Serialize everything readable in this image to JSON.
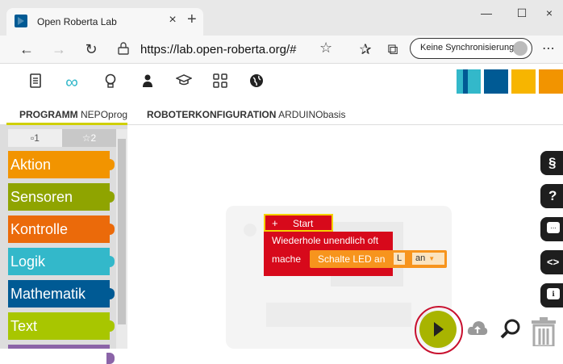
{
  "browser": {
    "tab_title": "Open Roberta Lab",
    "tab_close": "×",
    "new_tab": "+",
    "url": "https://lab.open-roberta.org/#",
    "sync_label": "Keine Synchronisierung",
    "more": "⋯",
    "minimize": "—",
    "maximize": "☐",
    "close": "×"
  },
  "app": {
    "toolbar_icons": [
      "document-icon",
      "infinity-icon",
      "lightbulb-icon",
      "user-icon",
      "graduation-cap-icon",
      "grid-icon",
      "globe-icon"
    ],
    "colors": {
      "accent": "#005a94",
      "yellow": "#f7b500",
      "green": "#a8b400"
    }
  },
  "tabs": {
    "program_label": "PROGRAMM",
    "program_name": "NEPOprog",
    "config_label": "ROBOTERKONFIGURATION",
    "config_name": "ARDUINObasis"
  },
  "toolbox": {
    "tab1": "▫1",
    "tab2": "☆2",
    "categories": [
      {
        "label": "Aktion",
        "color": "#f29400"
      },
      {
        "label": "Sensoren",
        "color": "#8fa400"
      },
      {
        "label": "Kontrolle",
        "color": "#eb6a0a"
      },
      {
        "label": "Logik",
        "color": "#33b8ca"
      },
      {
        "label": "Mathematik",
        "color": "#005a94"
      },
      {
        "label": "Text",
        "color": "#a8c600"
      }
    ]
  },
  "blocks": {
    "start_plus": "+",
    "start_label": "Start",
    "loop_label": "Wiederhole unendlich oft",
    "do_label": "mache",
    "led_label": "Schalte LED an",
    "led_pin": "L",
    "led_state": "an"
  },
  "side_buttons": [
    "§",
    "?",
    "▭",
    "<>",
    "💬"
  ]
}
